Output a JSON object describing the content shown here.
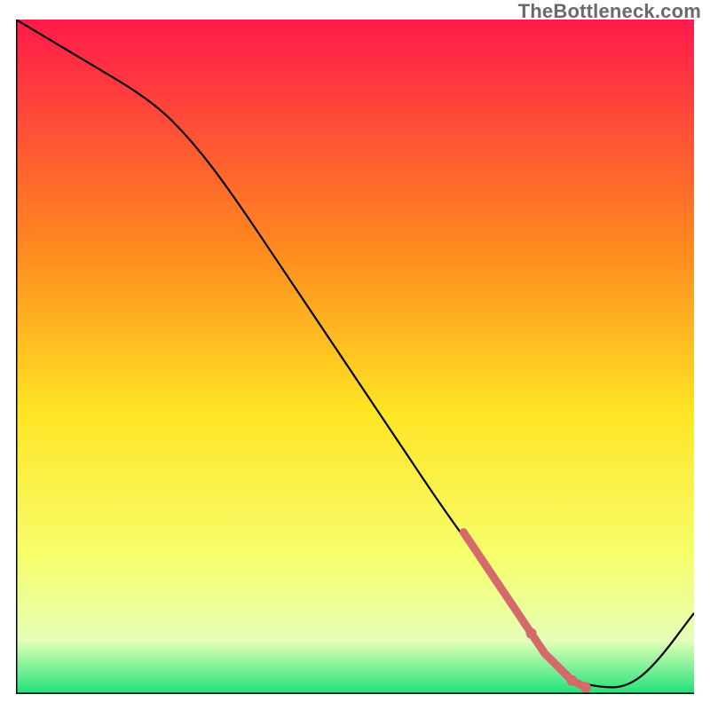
{
  "watermark": "TheBottleneck.com",
  "colors": {
    "gradient_top": "#ff1a4b",
    "gradient_mid_upper": "#ff8a1f",
    "gradient_mid": "#ffe424",
    "gradient_lower_yellow": "#f6ff6e",
    "gradient_pale": "#e6ffb8",
    "gradient_green": "#1de27a",
    "line": "#000000",
    "dot": "#d46a6a",
    "dot_stroke": "#d46a6a"
  },
  "chart_data": {
    "type": "line",
    "title": "",
    "xlabel": "",
    "ylabel": "",
    "xlim": [
      0,
      100
    ],
    "ylim": [
      0,
      100
    ],
    "grid": false,
    "legend": false,
    "series": [
      {
        "name": "bottleneck-curve",
        "x": [
          0,
          10,
          20,
          26,
          32,
          40,
          48,
          56,
          64,
          70,
          74,
          78,
          82,
          86,
          90,
          94,
          100
        ],
        "y": [
          100,
          94,
          88,
          82,
          74,
          62,
          50,
          38,
          26,
          18,
          12,
          6,
          2,
          1,
          1,
          4,
          12
        ]
      }
    ],
    "highlight_segment": {
      "name": "highlighted-range",
      "x": [
        66,
        68,
        70,
        72,
        74,
        76,
        78,
        80,
        82,
        84
      ],
      "y": [
        24,
        21,
        18,
        15,
        12,
        9,
        6,
        4,
        2,
        1
      ]
    },
    "extra_dots": [
      {
        "x": 76,
        "y": 9
      },
      {
        "x": 82,
        "y": 2
      },
      {
        "x": 84,
        "y": 1
      }
    ]
  }
}
